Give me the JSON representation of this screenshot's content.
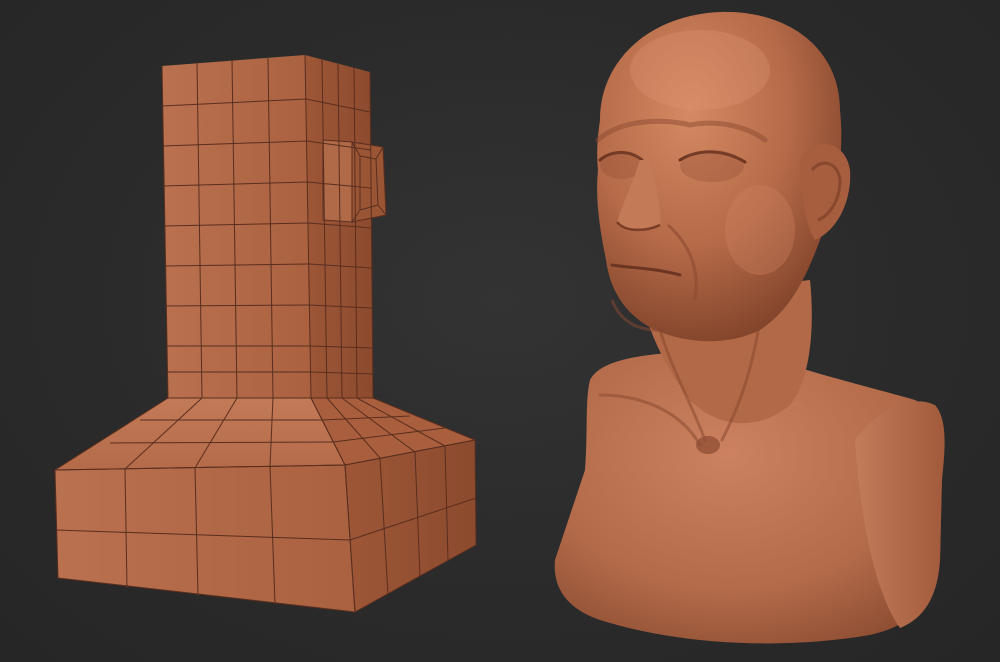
{
  "scene": {
    "background_color": "#2b2b2b",
    "clay_color": "#b2684a",
    "clay_light": "#c97a57",
    "clay_dark": "#8a4a33",
    "wire_color": "#5a2e1f",
    "objects": [
      {
        "name": "base-mesh-block",
        "description_icon": "cube-mesh-icon"
      },
      {
        "name": "sculpted-bust",
        "description_icon": "head-bust-icon"
      }
    ]
  }
}
